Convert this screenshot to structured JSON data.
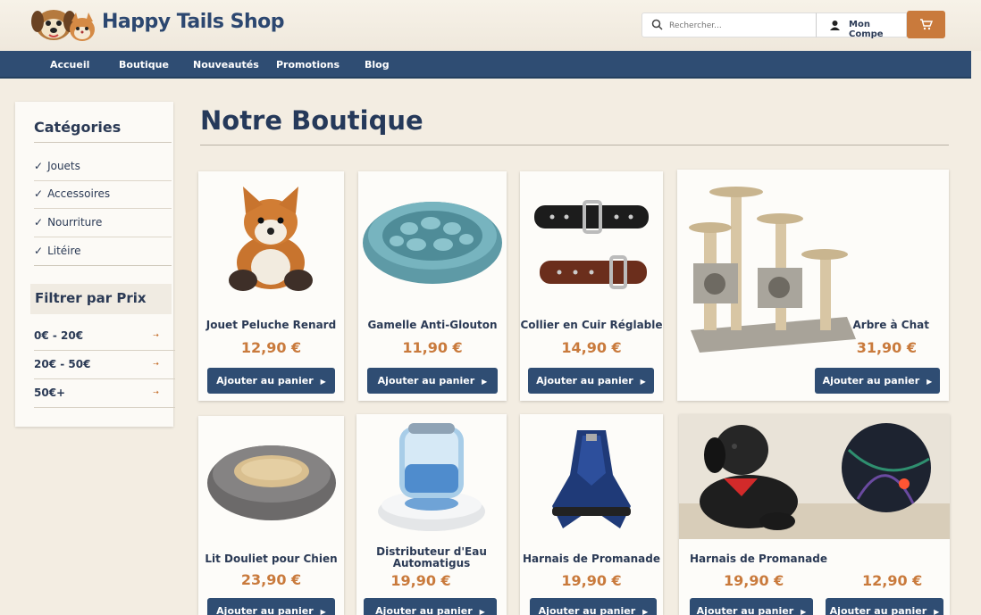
{
  "brand": {
    "name": "Happy Tails Shop"
  },
  "header": {
    "search_placeholder": "Rechercher...",
    "account_label": "Mon Compe"
  },
  "nav": {
    "items": [
      "Accueil",
      "Boutique",
      "Nouveautés",
      "Promotions",
      "Blog"
    ]
  },
  "sidebar": {
    "categories_title": "Catégories",
    "categories": [
      "Jouets",
      "Accessoires",
      "Nourriture",
      "Litéire"
    ],
    "check_glyph": "✓",
    "filter_title": "Filtrer par Prix",
    "price_ranges": [
      "0€ - 20€",
      "20€ - 50€",
      "50€+"
    ],
    "range_arrow": "⇢"
  },
  "main": {
    "title": "Notre Boutique",
    "add_label": "Ajouter au panier",
    "add_arrow": "▶",
    "products": [
      {
        "name": "Jouet Peluche Renard",
        "price": "12,90 €"
      },
      {
        "name": "Gamelle Anti-Glouton",
        "price": "11,90 €"
      },
      {
        "name": "Collier en Cuir Réglable",
        "price": "14,90 €"
      },
      {
        "name": "Arbre à Chat",
        "price": "31,90 €"
      },
      {
        "name": "Lit Douliet pour Chien",
        "price": "23,90 €"
      },
      {
        "name": "Distributeur d'Eau Automatigus",
        "price": "19,90 €"
      },
      {
        "name": "Harnais de Promanade",
        "price": "19,90 €"
      },
      {
        "name": "Harnais de Promanade",
        "price": "19,90 €"
      },
      {
        "name": "",
        "price": "12,90 €"
      }
    ]
  },
  "colors": {
    "navy": "#2f4d73",
    "accent_orange": "#c97a3c",
    "background": "#f3ede2"
  },
  "icons": {
    "search": "search-icon",
    "account": "user-icon",
    "cart": "cart-icon"
  }
}
